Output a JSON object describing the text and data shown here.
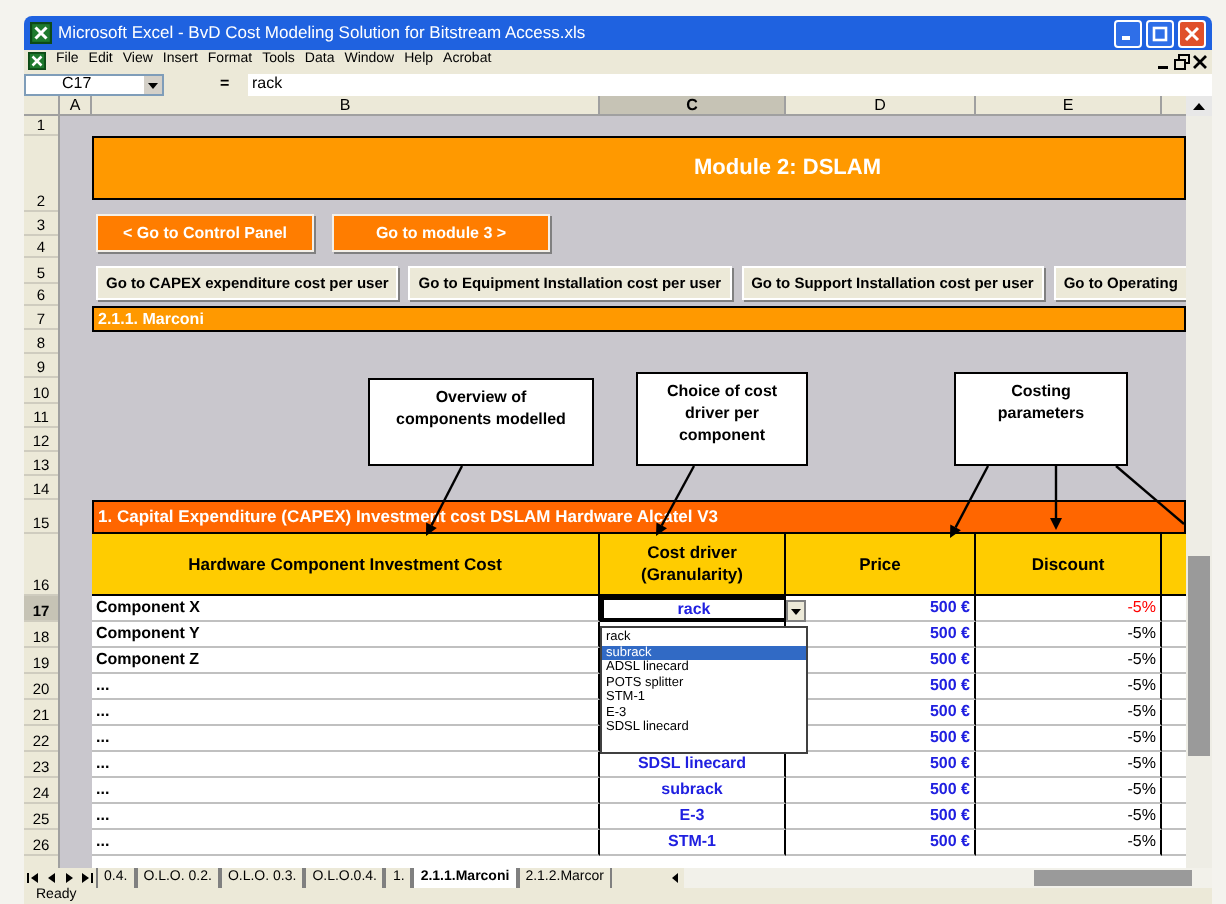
{
  "window": {
    "title": "Microsoft Excel - BvD Cost Modeling Solution for Bitstream Access.xls"
  },
  "menu": [
    "File",
    "Edit",
    "View",
    "Insert",
    "Format",
    "Tools",
    "Data",
    "Window",
    "Help",
    "Acrobat"
  ],
  "formula_bar": {
    "cell": "C17",
    "equals": "=",
    "value": "rack"
  },
  "columns": [
    {
      "label": "A",
      "selected": false
    },
    {
      "label": "B",
      "selected": false
    },
    {
      "label": "C",
      "selected": true
    },
    {
      "label": "D",
      "selected": false
    },
    {
      "label": "E",
      "selected": false
    }
  ],
  "row_numbers": [
    {
      "label": "1",
      "selected": false
    },
    {
      "label": "2",
      "selected": false
    },
    {
      "label": "3",
      "selected": false
    },
    {
      "label": "4",
      "selected": false
    },
    {
      "label": "5",
      "selected": false
    },
    {
      "label": "6",
      "selected": false
    },
    {
      "label": "7",
      "selected": false
    },
    {
      "label": "8",
      "selected": false
    },
    {
      "label": "9",
      "selected": false
    },
    {
      "label": "10",
      "selected": false
    },
    {
      "label": "11",
      "selected": false
    },
    {
      "label": "12",
      "selected": false
    },
    {
      "label": "13",
      "selected": false
    },
    {
      "label": "14",
      "selected": false
    },
    {
      "label": "15",
      "selected": false
    },
    {
      "label": "16",
      "selected": false
    },
    {
      "label": "17",
      "selected": true
    },
    {
      "label": "18",
      "selected": false
    },
    {
      "label": "19",
      "selected": false
    },
    {
      "label": "20",
      "selected": false
    },
    {
      "label": "21",
      "selected": false
    },
    {
      "label": "22",
      "selected": false
    },
    {
      "label": "23",
      "selected": false
    },
    {
      "label": "24",
      "selected": false
    },
    {
      "label": "25",
      "selected": false
    },
    {
      "label": "26",
      "selected": false
    }
  ],
  "sheet": {
    "title": "Module 2: DSLAM",
    "nav_buttons": [
      "< Go to Control Panel",
      "Go to module 3 >"
    ],
    "link_buttons": [
      "Go to CAPEX expenditure cost per user",
      "Go to Equipment Installation cost per user",
      "Go to Support Installation cost per user",
      "Go to Operating"
    ],
    "section": "2.1.1. Marconi",
    "callouts": [
      "Overview of components modelled",
      "Choice of cost driver per component",
      "Costing parameters"
    ],
    "table": {
      "title": "1. Capital Expenditure (CAPEX) Investment cost DSLAM Hardware Alcatel V3",
      "columns": [
        "Hardware Component Investment Cost",
        "Cost driver (Granularity)",
        "Price",
        "Discount"
      ],
      "rows": [
        {
          "component": "Component X",
          "driver": "rack",
          "price": "500 €",
          "discount": "-5%",
          "highlighted": true
        },
        {
          "component": "Component Y",
          "price": "500 €",
          "discount": "-5%",
          "highlighted": false
        },
        {
          "component": "Component Z",
          "price": "500 €",
          "discount": "-5%",
          "highlighted": false
        },
        {
          "component": "...",
          "price": "500 €",
          "discount": "-5%",
          "highlighted": false
        },
        {
          "component": "...",
          "price": "500 €",
          "discount": "-5%",
          "highlighted": false
        },
        {
          "component": "...",
          "price": "500 €",
          "discount": "-5%",
          "highlighted": false
        },
        {
          "component": "...",
          "driver": "SDSL linecard",
          "price": "500 €",
          "discount": "-5%",
          "highlighted": false
        },
        {
          "component": "...",
          "driver": "subrack",
          "price": "500 €",
          "discount": "-5%",
          "highlighted": false
        },
        {
          "component": "...",
          "driver": "E-3",
          "price": "500 €",
          "discount": "-5%",
          "highlighted": false
        },
        {
          "component": "...",
          "driver": "STM-1",
          "price": "500 €",
          "discount": "-5%",
          "highlighted": false
        }
      ]
    },
    "dropdown": {
      "items": [
        {
          "label": "rack",
          "selected": false
        },
        {
          "label": "subrack",
          "selected": true
        },
        {
          "label": "ADSL linecard",
          "selected": false
        },
        {
          "label": "POTS splitter",
          "selected": false
        },
        {
          "label": "STM-1",
          "selected": false
        },
        {
          "label": "E-3",
          "selected": false
        },
        {
          "label": "SDSL linecard",
          "selected": false
        }
      ]
    }
  },
  "sheet_tabs": [
    {
      "label": "0.4.",
      "selected": false
    },
    {
      "label": "O.L.O. 0.2.",
      "selected": false
    },
    {
      "label": "O.L.O. 0.3.",
      "selected": false
    },
    {
      "label": "O.L.O.0.4.",
      "selected": false
    },
    {
      "label": "1.",
      "selected": false
    },
    {
      "label": "2.1.1.Marconi",
      "selected": true
    },
    {
      "label": "2.1.2.Marcor",
      "selected": false
    }
  ],
  "status_bar": {
    "text": "Ready"
  }
}
